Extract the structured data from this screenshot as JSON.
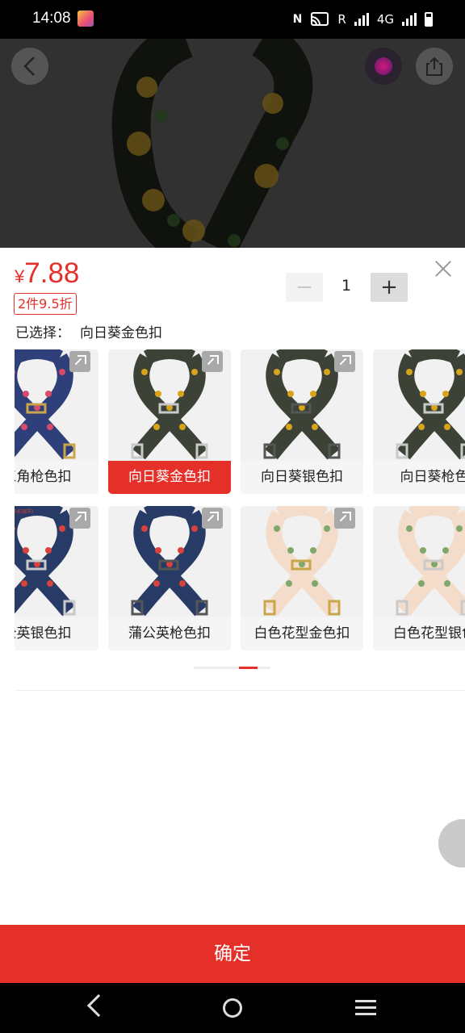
{
  "status_bar": {
    "time": "14:08",
    "r_label": "R",
    "network": "4G"
  },
  "preview": {
    "back_icon": "back-arrow-icon",
    "share_icon": "share-icon"
  },
  "product": {
    "currency": "¥",
    "price": "7.88",
    "promo": "2件9.5折",
    "selected_label": "已选择：",
    "selected_value": "向日葵金色扣",
    "quantity": "1",
    "minus": "−",
    "plus": "+"
  },
  "variants": [
    {
      "label": "三角枪色扣",
      "row": 0,
      "col": 0,
      "selected": false,
      "pattern": "triangle"
    },
    {
      "label": "向日葵金色扣",
      "row": 0,
      "col": 1,
      "selected": true,
      "pattern": "sunflower"
    },
    {
      "label": "向日葵银色扣",
      "row": 0,
      "col": 2,
      "selected": false,
      "pattern": "sunflower"
    },
    {
      "label": "向日葵枪色",
      "row": 0,
      "col": 3,
      "selected": false,
      "pattern": "sunflower"
    },
    {
      "label": "公英银色扣",
      "row": 1,
      "col": 0,
      "selected": false,
      "pattern": "dandelion",
      "caption": "5cm银色五金（卡扣调节）"
    },
    {
      "label": "蒲公英枪色扣",
      "row": 1,
      "col": 1,
      "selected": false,
      "pattern": "dandelion"
    },
    {
      "label": "白色花型金色扣",
      "row": 1,
      "col": 2,
      "selected": false,
      "pattern": "white"
    },
    {
      "label": "白色花型银色",
      "row": 1,
      "col": 3,
      "selected": false,
      "pattern": "white"
    }
  ],
  "confirm_label": "确定",
  "colors": {
    "accent": "#e5302a",
    "sunflower_strap": "#3c4236",
    "triangle_strap": "#2e3f7a",
    "dandelion_strap": "#283a66",
    "white_strap": "#f4dccb"
  }
}
